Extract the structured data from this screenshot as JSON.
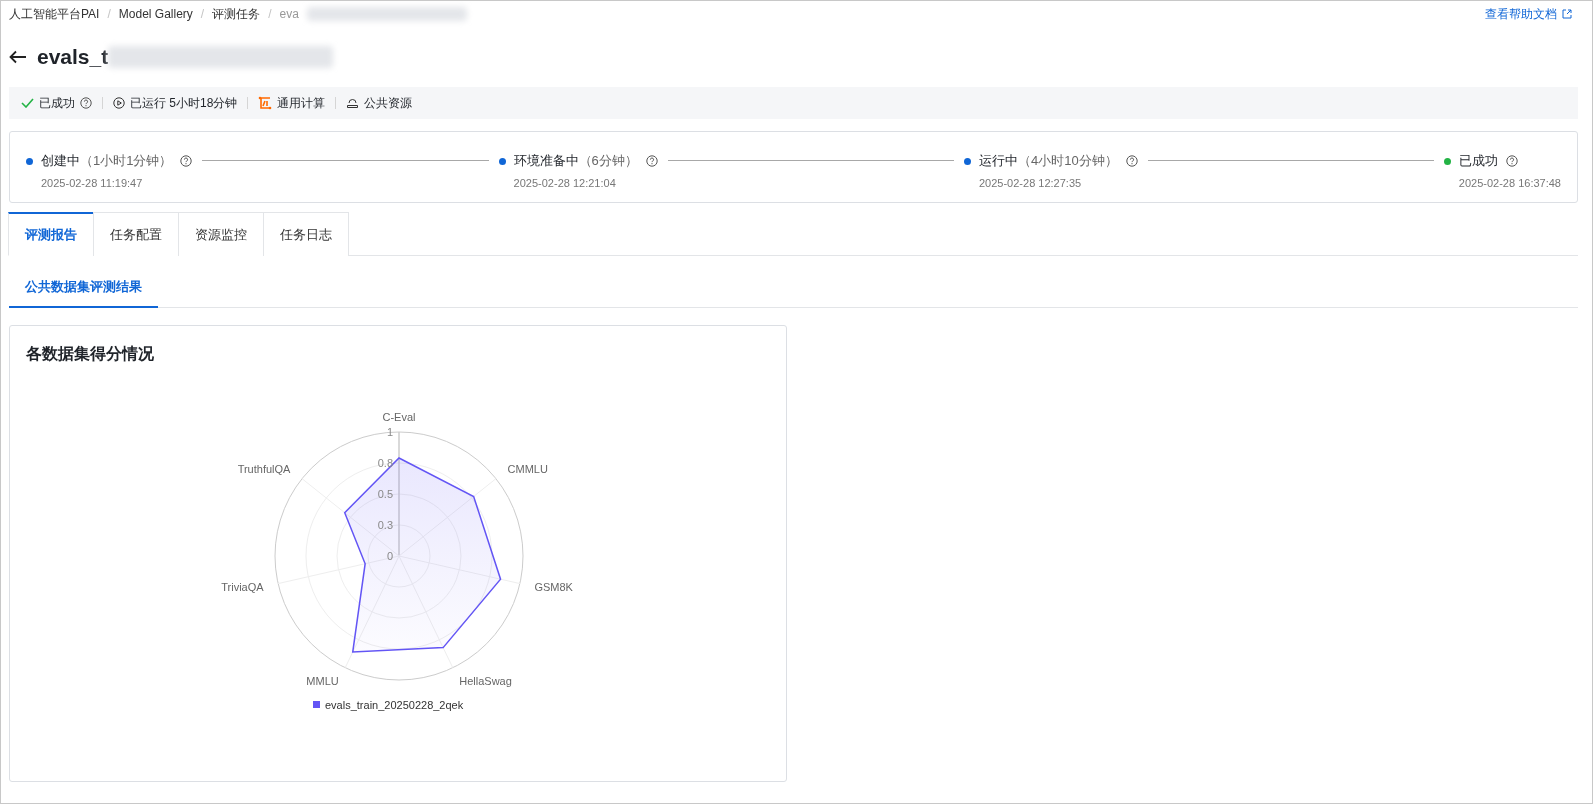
{
  "breadcrumb_separator": "/",
  "breadcrumb": [
    {
      "label": "人工智能平台PAI"
    },
    {
      "label": "Model Gallery"
    },
    {
      "label": "评测任务"
    },
    {
      "label": "eva",
      "redacted": true
    }
  ],
  "help_link": "查看帮助文档",
  "title": {
    "text": "evals_t",
    "redacted": true
  },
  "status_bar": [
    {
      "kind": "success",
      "label": "已成功",
      "help": true
    },
    {
      "kind": "runtime",
      "label": "已运行 5小时18分钟"
    },
    {
      "kind": "compute",
      "label": "通用计算"
    },
    {
      "kind": "resource",
      "label": "公共资源"
    }
  ],
  "timeline": [
    {
      "label": "创建中",
      "duration": "（1小时1分钟）",
      "time": "2025-02-28 11:19:47",
      "color": "#1066d6"
    },
    {
      "label": "环境准备中",
      "duration": "（6分钟）",
      "time": "2025-02-28 12:21:04",
      "color": "#1066d6"
    },
    {
      "label": "运行中",
      "duration": "（4小时10分钟）",
      "time": "2025-02-28 12:27:35",
      "color": "#1066d6"
    },
    {
      "label": "已成功",
      "time": "2025-02-28 16:37:48",
      "color": "#23b345"
    }
  ],
  "tabs": [
    {
      "label": "评测报告",
      "selected": true
    },
    {
      "label": "任务配置",
      "selected": false
    },
    {
      "label": "资源监控",
      "selected": false
    },
    {
      "label": "任务日志",
      "selected": false
    }
  ],
  "sub_tabs": [
    {
      "label": "公共数据集评测结果",
      "selected": true
    }
  ],
  "card": {
    "title": "各数据集得分情况",
    "radar": {
      "ticks": [
        "1",
        "0.8",
        "0.5",
        "0.3",
        "0"
      ],
      "axes": [
        {
          "label": "C-Eval"
        },
        {
          "label": "CMMLU"
        },
        {
          "label": "GSM8K"
        },
        {
          "label": "HellaSwag"
        },
        {
          "label": "MMLU"
        },
        {
          "label": "TriviaQA"
        },
        {
          "label": "TruthfulQA"
        }
      ],
      "legend": {
        "name": "evals_train_20250228_2qek",
        "color": "#6355f5"
      }
    }
  }
}
